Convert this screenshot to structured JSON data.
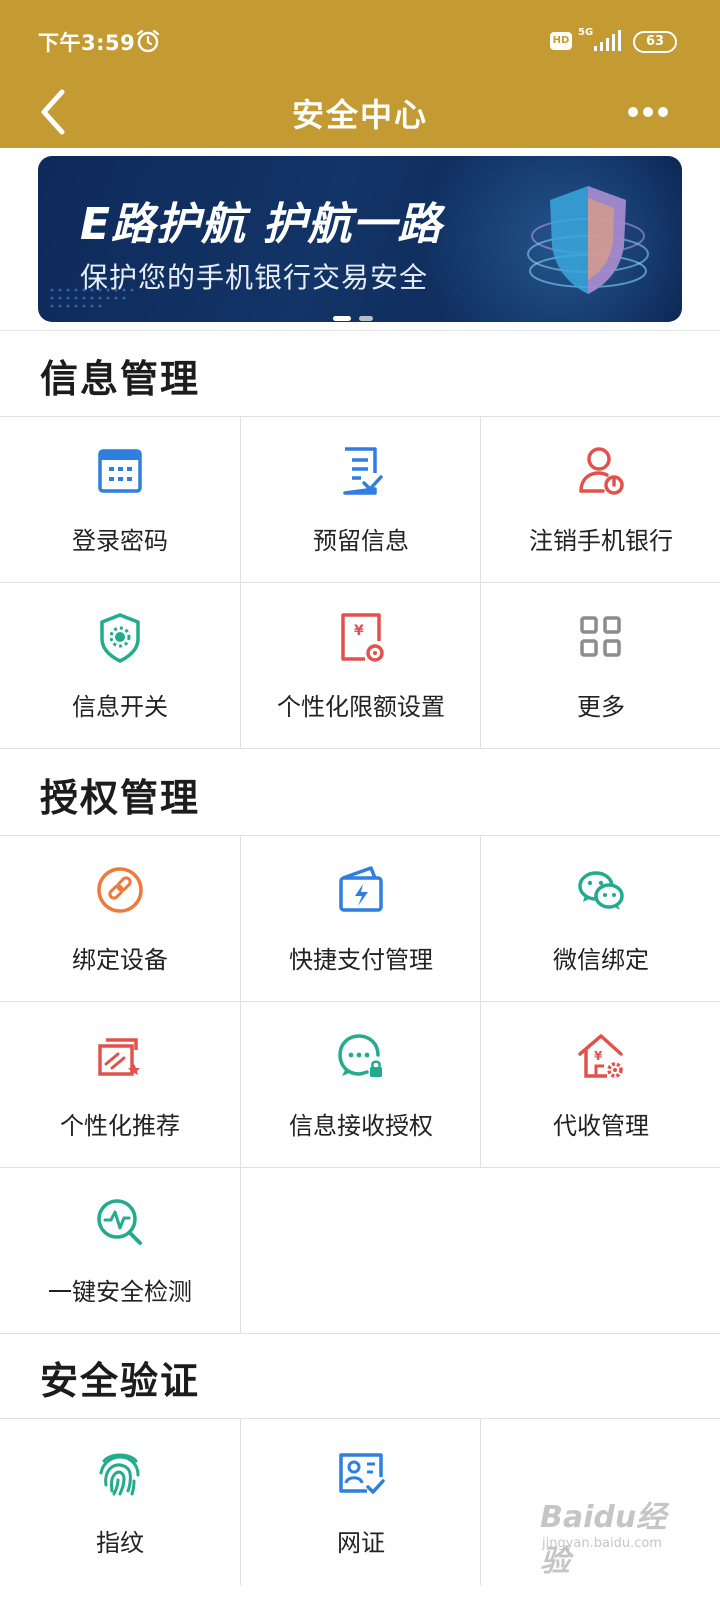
{
  "status_bar": {
    "time": "下午3:59",
    "hd": "HD",
    "network": "5G",
    "battery": "63"
  },
  "navbar": {
    "title": "安全中心"
  },
  "banner": {
    "headline": "E路护航 护航一路",
    "subtitle": "保护您的手机银行交易安全",
    "active_page": 1,
    "page_count": 2
  },
  "sections": [
    {
      "title": "信息管理",
      "items": [
        {
          "label": "登录密码",
          "icon": "keypad-icon"
        },
        {
          "label": "预留信息",
          "icon": "document-check-icon"
        },
        {
          "label": "注销手机银行",
          "icon": "user-power-icon"
        },
        {
          "label": "信息开关",
          "icon": "shield-gear-icon"
        },
        {
          "label": "个性化限额设置",
          "icon": "yuan-limit-icon"
        },
        {
          "label": "更多",
          "icon": "grid-more-icon"
        }
      ]
    },
    {
      "title": "授权管理",
      "items": [
        {
          "label": "绑定设备",
          "icon": "link-icon"
        },
        {
          "label": "快捷支付管理",
          "icon": "wallet-bolt-icon"
        },
        {
          "label": "微信绑定",
          "icon": "wechat-icon"
        },
        {
          "label": "个性化推荐",
          "icon": "recommend-icon"
        },
        {
          "label": "信息接收授权",
          "icon": "message-lock-icon"
        },
        {
          "label": "代收管理",
          "icon": "house-yuan-icon"
        },
        {
          "label": "一键安全检测",
          "icon": "scan-pulse-icon"
        }
      ]
    },
    {
      "title": "安全验证",
      "items": [
        {
          "label": "指纹",
          "icon": "fingerprint-icon"
        },
        {
          "label": "网证",
          "icon": "id-card-check-icon"
        }
      ]
    }
  ],
  "watermark": {
    "brand": "Baidu经验",
    "url": "jingyan.baidu.com"
  },
  "colors": {
    "header": "#c49a33",
    "blue": "#2f7fe0",
    "red": "#e2524d",
    "green": "#22ab8c",
    "orange": "#ee7a3b",
    "gray": "#8c8c8c"
  }
}
